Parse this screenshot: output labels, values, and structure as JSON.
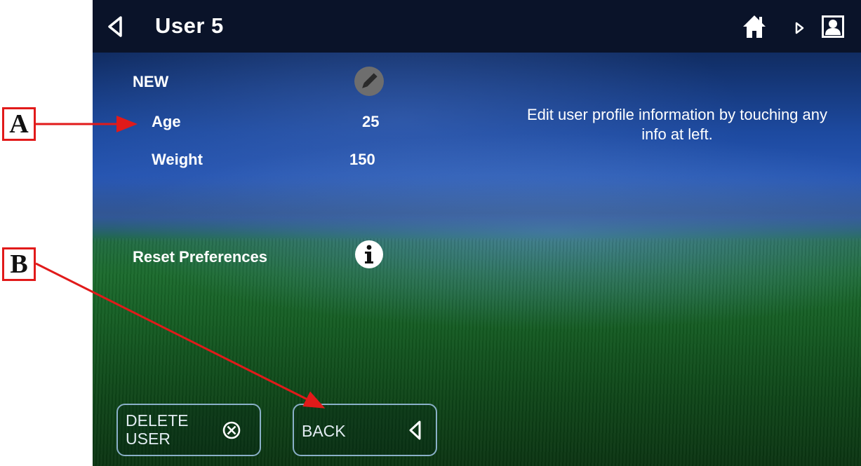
{
  "header": {
    "title": "User 5"
  },
  "profile": {
    "name": "NEW",
    "fields": [
      {
        "label": "Age",
        "value": "25"
      },
      {
        "label": "Weight",
        "value": "150"
      }
    ],
    "reset_label": "Reset Preferences"
  },
  "help_text": "Edit user profile information by touching any info at left.",
  "buttons": {
    "delete_line1": "DELETE",
    "delete_line2": "USER",
    "back": "BACK"
  },
  "callouts": {
    "a": "A",
    "b": "B"
  },
  "icons": {
    "back": "back-arrow-icon",
    "home": "home-icon",
    "next": "next-arrow-icon",
    "profile": "user-profile-icon",
    "edit": "pencil-icon",
    "info": "info-icon",
    "delete": "delete-x-circle-icon"
  },
  "colors": {
    "header_bg": "#0a1329",
    "text": "#ffffff",
    "button_border": "#8ab0c8",
    "callout_red": "#e11a1a"
  }
}
